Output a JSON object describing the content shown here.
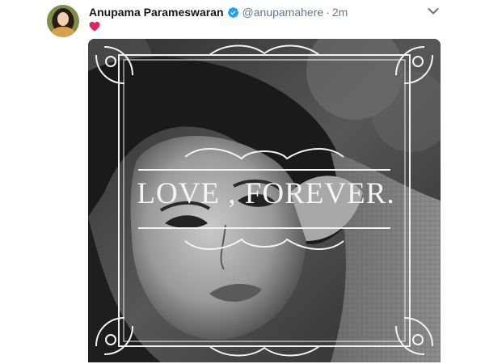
{
  "tweet": {
    "author_name": "Anupama Parameswaran",
    "handle": "@anupamahere",
    "separator": "·",
    "timestamp": "2m",
    "verified": true,
    "text_emoji": "heart-icon",
    "media": {
      "overlay_text": "LOVE , FOREVER."
    }
  },
  "icons": {
    "verified": "verified-badge-icon",
    "menu": "chevron-down-icon",
    "heart": "heart-icon"
  },
  "colors": {
    "verified_blue": "#1da1f2",
    "heart_red": "#e0245e",
    "name_text": "#14171a",
    "secondary_text": "#657786"
  }
}
